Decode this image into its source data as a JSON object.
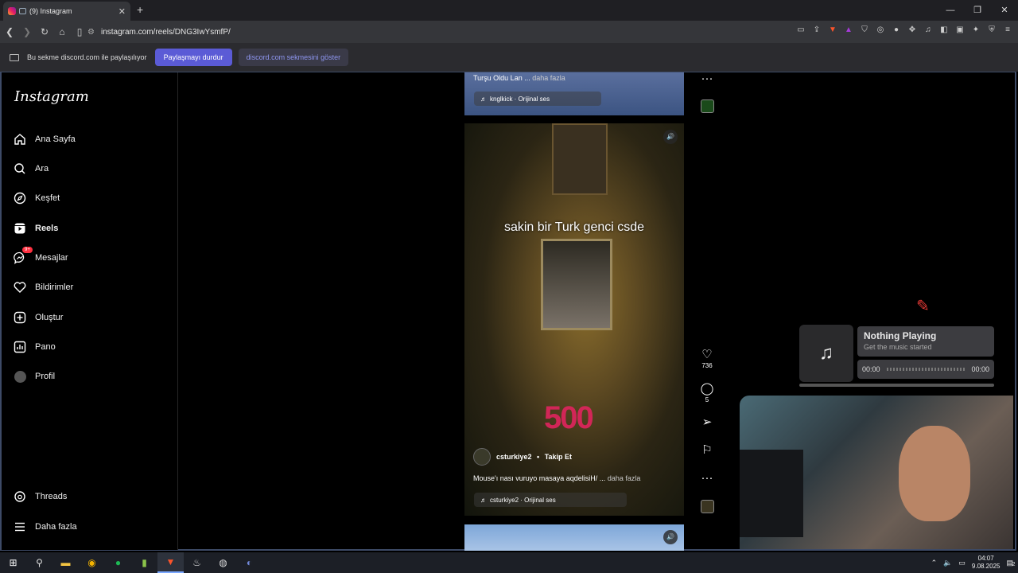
{
  "browser": {
    "tab_title": "(9) Instagram",
    "tab_close": "✕",
    "new_tab": "+",
    "url": "instagram.com/reels/DNG3IwYsmfP/",
    "share_notice": "Bu sekme discord.com ile paylaşılıyor",
    "stop_sharing": "Paylaşmayı durdur",
    "show_tab": "discord.com sekmesini göster"
  },
  "sidebar": {
    "logo": "Instagram",
    "items": [
      {
        "label": "Ana Sayfa",
        "icon": "home-icon"
      },
      {
        "label": "Ara",
        "icon": "search-icon"
      },
      {
        "label": "Keşfet",
        "icon": "compass-icon"
      },
      {
        "label": "Reels",
        "icon": "reels-icon"
      },
      {
        "label": "Mesajlar",
        "icon": "messenger-icon",
        "badge": "9+"
      },
      {
        "label": "Bildirimler",
        "icon": "heart-icon"
      },
      {
        "label": "Oluştur",
        "icon": "plus-square-icon"
      },
      {
        "label": "Pano",
        "icon": "dashboard-icon"
      },
      {
        "label": "Profil",
        "icon": "avatar"
      }
    ],
    "bottom": [
      {
        "label": "Threads",
        "icon": "threads-icon"
      },
      {
        "label": "Daha fazla",
        "icon": "menu-icon"
      }
    ]
  },
  "reel_top": {
    "caption": "Turşu Oldu Lan ...",
    "more": "daha fazla",
    "audio": "knglkick · Orijinal ses"
  },
  "reel_main": {
    "overlay_text": "sakin bir Turk genci csde",
    "watermark": "500",
    "username": "csturkiye2",
    "dot": "•",
    "follow": "Takip Et",
    "caption": "Mouse'ı nası vuruyo masaya aqdelisiH/ ...",
    "more": "daha fazla",
    "audio": "csturkiye2 · Orijinal ses"
  },
  "actions": {
    "likes": "736",
    "comments": "5"
  },
  "music_player": {
    "title": "Nothing Playing",
    "subtitle": "Get the music started",
    "time_start": "00:00",
    "time_end": "00:00"
  },
  "taskbar": {
    "time": "04:07",
    "date": "9.08.2025",
    "notifications": "2"
  }
}
